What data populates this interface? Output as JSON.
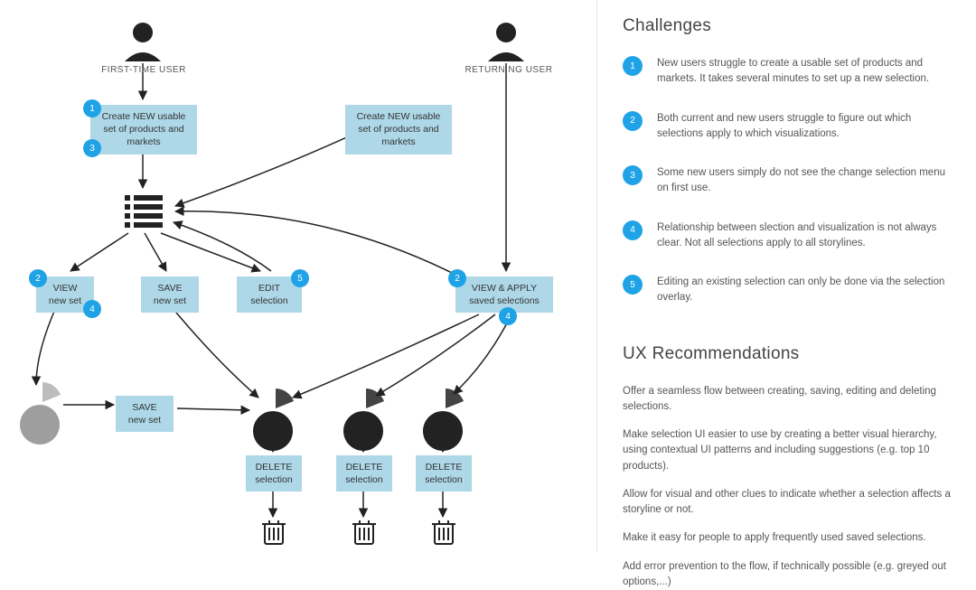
{
  "diagram": {
    "user1_label": "FIRST-TIME USER",
    "user2_label": "RETURNING USER",
    "sticky_create1": "Create NEW usable\nset of products and\nmarkets",
    "sticky_create2": "Create NEW usable\nset of products and\nmarkets",
    "sticky_view": "VIEW\nnew set",
    "sticky_save1": "SAVE\nnew set",
    "sticky_edit": "EDIT\nselection",
    "sticky_viewapply": "VIEW & APPLY\nsaved selections",
    "sticky_save2": "SAVE\nnew set",
    "sticky_delete1": "DELETE\nselection",
    "sticky_delete2": "DELETE\nselection",
    "sticky_delete3": "DELETE\nselection",
    "badges": {
      "a1": "1",
      "a3": "3",
      "b2": "2",
      "b4": "4",
      "c5": "5",
      "d2": "2",
      "d4": "4"
    }
  },
  "challenges_title": "Challenges",
  "challenges": [
    {
      "num": "1",
      "text": "New users struggle to create a usable set of products and markets. It takes several minutes to set up a new selection."
    },
    {
      "num": "2",
      "text": "Both current and new users struggle to figure out which selections apply to which visualizations."
    },
    {
      "num": "3",
      "text": "Some new users simply do not see the change selection menu on first use."
    },
    {
      "num": "4",
      "text": "Relationship between slection and visualization is not always clear. Not all selections apply to all storylines."
    },
    {
      "num": "5",
      "text": "Editing an existing selection can only be done via the selection overlay."
    }
  ],
  "rec_title": "UX Recommendations",
  "recs": [
    "Offer a seamless flow between creating, saving, editing and deleting selections.",
    "Make selection UI easier to use by creating a better visual hierarchy, using contextual UI patterns and including suggestions (e.g. top 10 products).",
    "Allow for visual and other clues to indicate whether a selection affects a storyline or not.",
    "Make it easy for people to apply frequently used saved selections.",
    "Add error prevention to the flow, if technically possible (e.g. greyed out options,...)"
  ]
}
